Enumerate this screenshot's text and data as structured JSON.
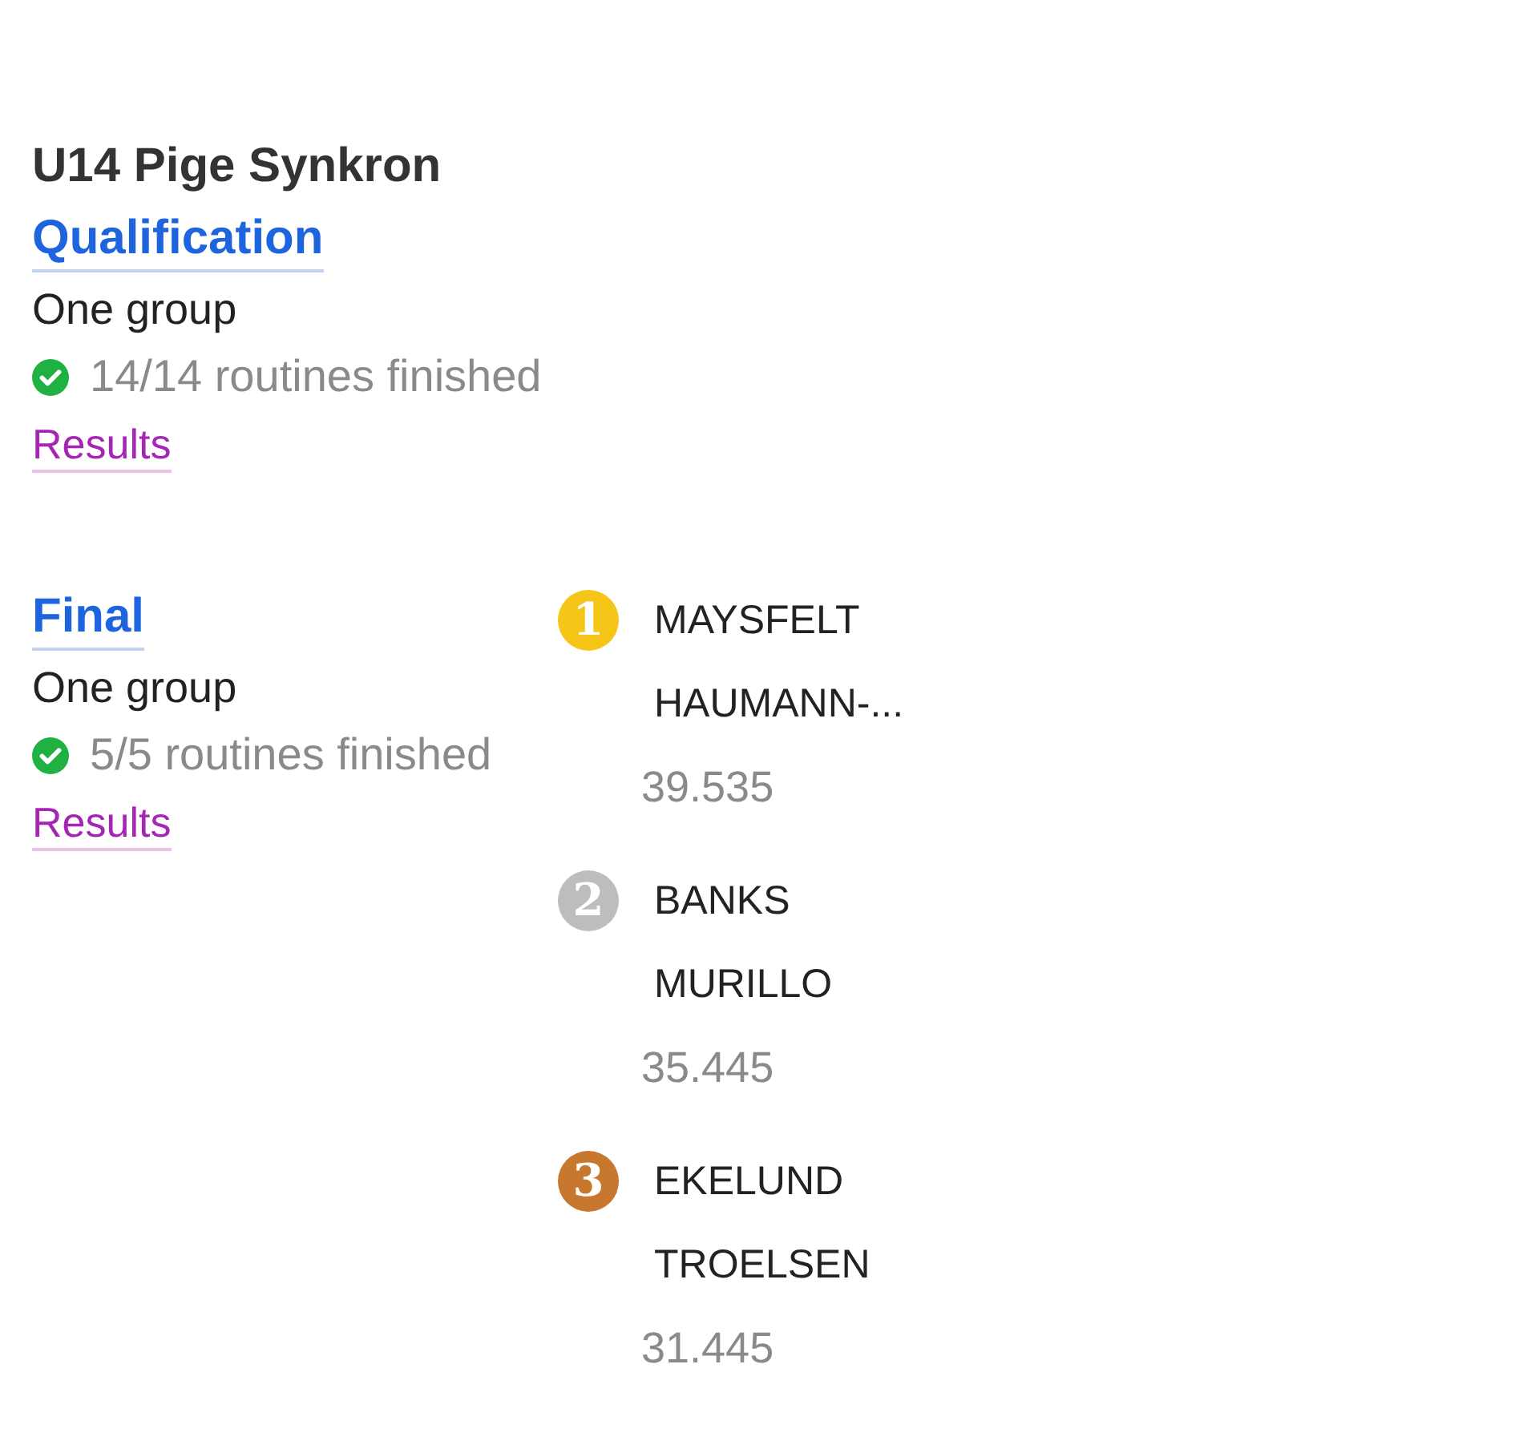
{
  "event": {
    "title": "U14 Pige Synkron"
  },
  "rounds": [
    {
      "name": "Qualification",
      "groups": "One group",
      "finished": true,
      "status": "14/14 routines finished",
      "link": "Results"
    },
    {
      "name": "Final",
      "groups": "One group",
      "finished": true,
      "status": "5/5 routines finished",
      "link": "Results",
      "podium": [
        {
          "rank": "1",
          "color": "#f5c518",
          "names": [
            "MAYSFELT",
            "HAUMANN-..."
          ],
          "score": "39.535"
        },
        {
          "rank": "2",
          "color": "#bdbdbd",
          "names": [
            "BANKS",
            "MURILLO"
          ],
          "score": "35.445"
        },
        {
          "rank": "3",
          "color": "#c8772e",
          "names": [
            "EKELUND",
            "TROELSEN"
          ],
          "score": "31.445"
        }
      ]
    }
  ]
}
